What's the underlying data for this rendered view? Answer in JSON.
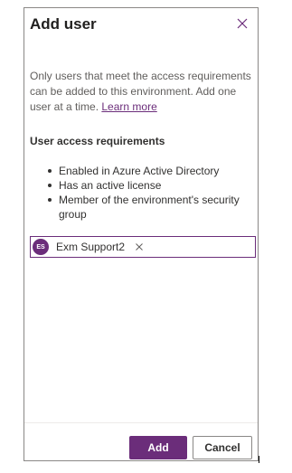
{
  "panel": {
    "title": "Add user",
    "close_icon": "close-icon"
  },
  "description": {
    "text": "Only users that meet the access requirements can be added to this environment. Add one user at a time.",
    "link_label": "Learn more"
  },
  "requirements": {
    "heading": "User access requirements",
    "items": [
      "Enabled in Azure Active Directory",
      "Has an active license",
      "Member of the environment's security group"
    ]
  },
  "people_picker": {
    "selected": {
      "initials": "ES",
      "name": "Exm Support2",
      "remove_icon": "close-icon"
    }
  },
  "footer": {
    "primary_label": "Add",
    "secondary_label": "Cancel"
  },
  "colors": {
    "accent": "#6b2d7a",
    "border": "#8a8886",
    "text": "#323130",
    "muted_text": "#605e5c"
  }
}
